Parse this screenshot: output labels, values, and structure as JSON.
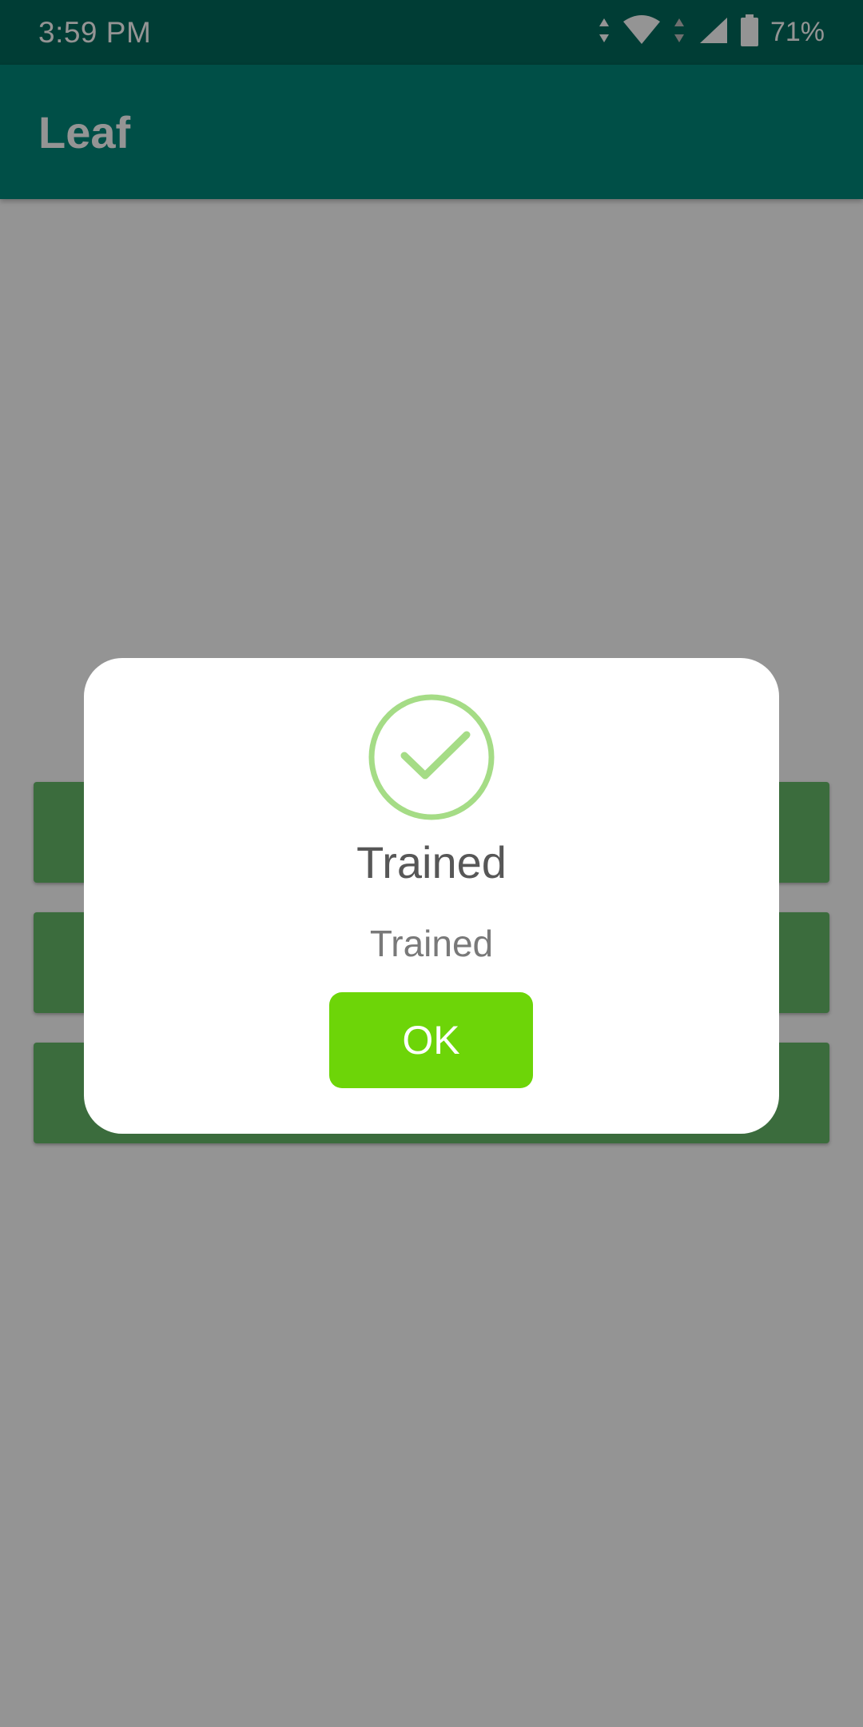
{
  "status_bar": {
    "time": "3:59 PM",
    "battery_percent": "71%",
    "icons": [
      "data-arrows-icon",
      "wifi-icon",
      "cell-signal-icon",
      "battery-icon"
    ]
  },
  "app_bar": {
    "title": "Leaf",
    "color": "#00897b",
    "status_color": "#00695c"
  },
  "content": {
    "buttons": [
      {
        "label": ""
      },
      {
        "label": ""
      },
      {
        "label": ""
      }
    ],
    "button_color": "#66bb6a"
  },
  "dialog": {
    "icon": "check-circle-icon",
    "icon_color": "#a5dc86",
    "title": "Trained",
    "message": "Trained",
    "confirm_label": "OK",
    "confirm_color": "#6dd508"
  }
}
